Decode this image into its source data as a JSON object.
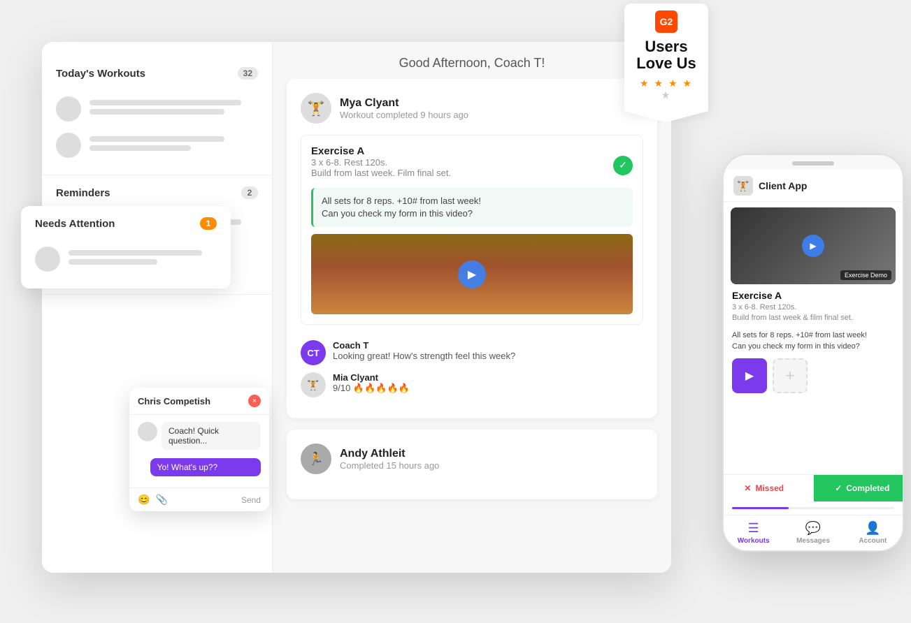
{
  "app": {
    "greeting": "Good Afternoon, Coach T!",
    "sidebar": {
      "todays_workouts": {
        "title": "Today's Workouts",
        "count": "32"
      },
      "needs_attention": {
        "title": "Needs Attention",
        "count": "1"
      },
      "reminders": {
        "title": "Reminders",
        "count": "2"
      }
    }
  },
  "workout_card": {
    "user_name": "Mya Clyant",
    "user_sub": "Workout completed 9 hours ago",
    "exercise_title": "Exercise A",
    "exercise_details": "3 x 6-8. Rest 120s.",
    "exercise_note": "Build from last week. Film final set.",
    "client_message_line1": "All sets for 8 reps. +10# from last week!",
    "client_message_line2": "Can you check my form in this video?",
    "coach_name": "Coach T",
    "coach_message": "Looking great! How's strength feel this week?",
    "client_name2": "Mia Clyant",
    "client_rating": "9/10 🔥🔥🔥🔥🔥"
  },
  "workout_card2": {
    "user_name": "Andy Athleit",
    "user_sub": "Completed 15 hours ago"
  },
  "chat": {
    "title": "Chris Competish",
    "received_msg": "Coach! Quick question...",
    "sent_msg": "Yo! What's up??",
    "send_label": "Send"
  },
  "phone": {
    "app_title": "Client App",
    "exercise_title": "Exercise A",
    "exercise_details": "3 x 6-8. Rest 120s.",
    "exercise_note": "Build from last week & film final set.",
    "message_line1": "All sets for 8 reps. +10# from last week!",
    "message_line2": "Can you check my form in this video?",
    "video_overlay": "Exercise Demo",
    "missed_label": "Missed",
    "completed_label": "Completed",
    "nav_workouts": "Workouts",
    "nav_messages": "Messages",
    "nav_account": "Account"
  },
  "g2": {
    "logo_text": "G2",
    "title_line1": "Users",
    "title_line2": "Love Us"
  }
}
